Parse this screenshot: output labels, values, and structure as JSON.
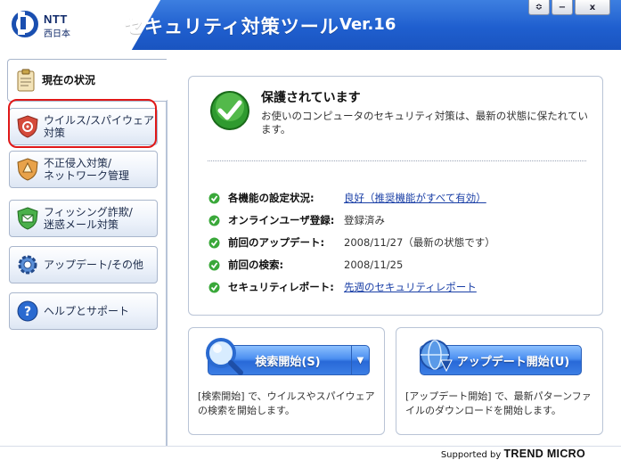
{
  "header": {
    "logo_brand": "NTT",
    "logo_sub": "西日本",
    "title": "セキュリティ対策ツール",
    "version": "Ver.16",
    "controls": [
      "≎",
      "−",
      "x"
    ]
  },
  "sidebar": {
    "items": [
      {
        "label": "現在の状況",
        "active": true
      },
      {
        "label": "ウイルス/スパイウェア\n対策"
      },
      {
        "label": "不正侵入対策/\nネットワーク管理",
        "highlighted": true
      },
      {
        "label": "フィッシング詐欺/\n迷惑メール対策"
      },
      {
        "label": "アップデート/その他"
      },
      {
        "label": "ヘルプとサポート"
      }
    ]
  },
  "status": {
    "title": "保護されています",
    "description": "お使いのコンピュータのセキュリティ対策は、最新の状態に保たれています。",
    "rows": [
      {
        "label": "各機能の設定状況:",
        "value": "良好（推奨機能がすべて有効）",
        "link": true
      },
      {
        "label": "オンラインユーザ登録:",
        "value": "登録済み",
        "link": false
      },
      {
        "label": "前回のアップデート:",
        "value": "2008/11/27（最新の状態です）",
        "link": false
      },
      {
        "label": "前回の検索:",
        "value": "2008/11/25",
        "link": false
      },
      {
        "label": "セキュリティレポート:",
        "value": "先週のセキュリティレポート",
        "link": true
      }
    ]
  },
  "scan": {
    "button_label": "検索開始(S)",
    "dropdown": "▼",
    "description": "[検索開始] で、ウイルスやスパイウェアの検索を開始します。"
  },
  "update": {
    "button_label": "アップデート開始(U)",
    "description": "[アップデート開始] で、最新パターンファイルのダウンロードを開始します。"
  },
  "footer": {
    "supported_by": "Supported by",
    "brand": "TREND MICRO"
  },
  "colors": {
    "header_blue": "#1f5fcf",
    "accent_green": "#3aa83a",
    "link_blue": "#1a3fa6",
    "highlight_red": "#e01818"
  }
}
